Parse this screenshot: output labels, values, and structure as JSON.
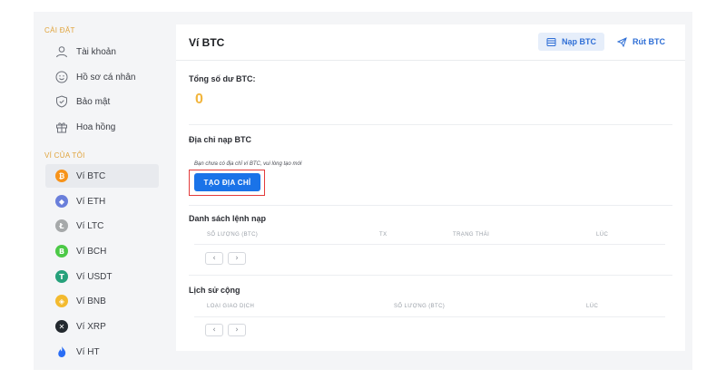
{
  "sidebar": {
    "settings_title": "CÀI ĐẶT",
    "settings_items": [
      {
        "label": "Tài khoản",
        "icon": "user-icon"
      },
      {
        "label": "Hồ sơ cá nhân",
        "icon": "smile-icon"
      },
      {
        "label": "Bảo mật",
        "icon": "shield-icon"
      },
      {
        "label": "Hoa hồng",
        "icon": "gift-icon"
      }
    ],
    "wallet_title": "VÍ CỦA TÔI",
    "wallet_items": [
      {
        "label": "Ví BTC",
        "icon": "btc-icon",
        "color": "#f7931a",
        "active": true
      },
      {
        "label": "Ví ETH",
        "icon": "eth-icon",
        "color": "#6a7fdb"
      },
      {
        "label": "Ví LTC",
        "icon": "ltc-icon",
        "color": "#a6a9aa"
      },
      {
        "label": "Ví BCH",
        "icon": "bch-icon",
        "color": "#4cc947"
      },
      {
        "label": "Ví USDT",
        "icon": "usdt-icon",
        "color": "#26a17b"
      },
      {
        "label": "Ví BNB",
        "icon": "bnb-icon",
        "color": "#f3ba2f"
      },
      {
        "label": "Ví XRP",
        "icon": "xrp-icon",
        "color": "#23292f"
      },
      {
        "label": "Ví HT",
        "icon": "ht-icon",
        "color": "#2a6df5"
      }
    ]
  },
  "main": {
    "title": "Ví BTC",
    "deposit_button": "Nạp BTC",
    "withdraw_button": "Rút BTC",
    "balance_label": "Tổng số dư BTC:",
    "balance_value": "0",
    "address_label": "Địa chỉ nạp BTC",
    "address_note": "Bạn chưa có địa chỉ ví BTC, vui lòng tạo mới",
    "create_button": "TẠO ĐỊA CHỈ",
    "deposit_list_title": "Danh sách lệnh nạp",
    "deposit_columns": [
      "SỐ LƯỢNG (BTC)",
      "TX",
      "TRẠNG THÁI",
      "LÚC"
    ],
    "history_title": "Lịch sử cộng",
    "history_columns": [
      "LOẠI GIAO DỊCH",
      "SỐ LƯỢNG (BTC)",
      "LÚC"
    ],
    "prev_page": "‹",
    "next_page": "›"
  },
  "colors": {
    "accent": "#1a73e8",
    "section_title": "#e0a33b",
    "balance": "#f2b53c",
    "highlight_box": "#e33b3b"
  }
}
